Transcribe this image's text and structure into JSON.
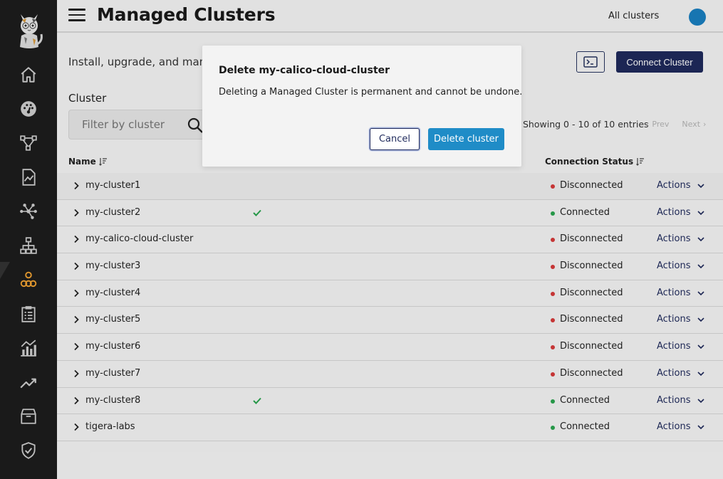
{
  "sidebar": {
    "logo_icon": "calico-cat-logo-icon",
    "items": [
      {
        "icon": "home-icon"
      },
      {
        "icon": "dashboard-icon"
      },
      {
        "icon": "service-graph-icon"
      },
      {
        "icon": "policies-icon"
      },
      {
        "icon": "endpoints-icon"
      },
      {
        "icon": "network-sets-icon"
      },
      {
        "icon": "managed-clusters-icon",
        "active": true,
        "active_color": "#f0a232"
      },
      {
        "icon": "compliance-reports-icon"
      },
      {
        "icon": "activity-icon"
      },
      {
        "icon": "timeline-icon"
      },
      {
        "icon": "image-assurance-icon"
      },
      {
        "icon": "threat-defense-icon"
      }
    ]
  },
  "header": {
    "title": "Managed Clusters",
    "cluster_selector": "All clusters",
    "avatar_color": "#1a7fc1"
  },
  "page": {
    "subtitle": "Install, upgrade, and mana",
    "connect_button_label": "Connect Cluster",
    "filter_label": "Cluster",
    "filter_placeholder": "Filter by cluster",
    "showing_text": "Showing 0 - 10 of 10 entries",
    "prev_label": "Prev",
    "next_label": "Next"
  },
  "table": {
    "col_name": "Name",
    "col_status": "Connection Status",
    "rows": [
      {
        "name": "my-cluster1",
        "check": false,
        "status": "Disconnected",
        "action": "Actions"
      },
      {
        "name": "my-cluster2",
        "check": true,
        "status": "Connected",
        "action": "Actions"
      },
      {
        "name": "my-calico-cloud-cluster",
        "check": false,
        "status": "Disconnected",
        "action": "Actions"
      },
      {
        "name": "my-cluster3",
        "check": false,
        "status": "Disconnected",
        "action": "Actions"
      },
      {
        "name": "my-cluster4",
        "check": false,
        "status": "Disconnected",
        "action": "Actions"
      },
      {
        "name": "my-cluster5",
        "check": false,
        "status": "Disconnected",
        "action": "Actions"
      },
      {
        "name": "my-cluster6",
        "check": false,
        "status": "Disconnected",
        "action": "Actions"
      },
      {
        "name": "my-cluster7",
        "check": false,
        "status": "Disconnected",
        "action": "Actions"
      },
      {
        "name": "my-cluster8",
        "check": true,
        "status": "Connected",
        "action": "Actions"
      },
      {
        "name": "tigera-labs",
        "check": false,
        "status": "Connected",
        "action": "Actions"
      }
    ]
  },
  "colors": {
    "connected": "#2aa44f",
    "disconnected": "#d63a3a",
    "primary": "#1f2a5c",
    "delete": "#1f8cc7"
  },
  "modal": {
    "title": "Delete my-calico-cloud-cluster",
    "body": "Deleting a Managed Cluster is permanent and cannot be undone.",
    "cancel_label": "Cancel",
    "delete_label": "Delete cluster"
  }
}
